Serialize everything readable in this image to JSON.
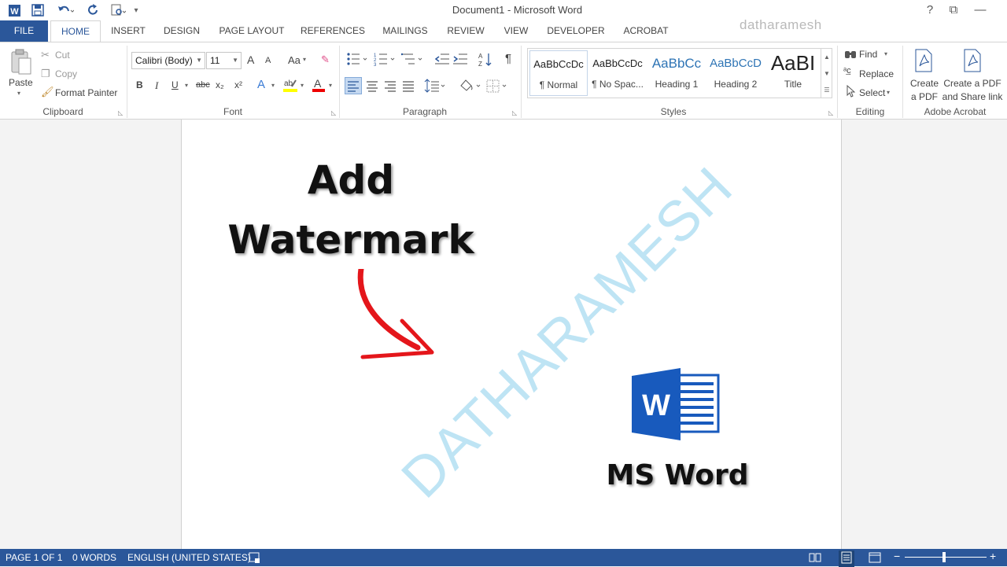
{
  "title_bar": {
    "app_icon": "word-icon",
    "save_icon": "save-icon",
    "undo_icon": "undo-icon",
    "redo_icon": "redo-icon",
    "print_preview_icon": "print-preview-icon",
    "customize_icon": "customize-qat-icon",
    "document_title": "Document1 - Microsoft Word",
    "account_name": "datharamesh",
    "help": "?",
    "ribbon_options": "⧉",
    "minimize": "—"
  },
  "tabs": [
    {
      "label": "FILE"
    },
    {
      "label": "HOME"
    },
    {
      "label": "INSERT"
    },
    {
      "label": "DESIGN"
    },
    {
      "label": "PAGE LAYOUT"
    },
    {
      "label": "REFERENCES"
    },
    {
      "label": "MAILINGS"
    },
    {
      "label": "REVIEW"
    },
    {
      "label": "VIEW"
    },
    {
      "label": "DEVELOPER"
    },
    {
      "label": "ACROBAT"
    }
  ],
  "clipboard": {
    "paste": "Paste",
    "cut": "Cut",
    "copy": "Copy",
    "format_painter": "Format Painter",
    "group_label": "Clipboard"
  },
  "font": {
    "font_name": "Calibri (Body)",
    "font_size": "11",
    "group_label": "Font",
    "bold": "B",
    "italic": "I",
    "underline": "U",
    "strikethrough": "abc",
    "subscript": "x₂",
    "superscript": "x²",
    "grow": "A",
    "shrink": "A",
    "change_case": "Aa"
  },
  "paragraph": {
    "group_label": "Paragraph",
    "sort": "A↓Z",
    "pilcrow": "¶"
  },
  "styles": {
    "group_label": "Styles",
    "items": [
      {
        "preview": "AaBbCcDc",
        "name": "¶ Normal"
      },
      {
        "preview": "AaBbCcDc",
        "name": "¶ No Spac..."
      },
      {
        "preview": "AaBbCc",
        "name": "Heading 1"
      },
      {
        "preview": "AaBbCcD",
        "name": "Heading 2"
      },
      {
        "preview": "AaBI",
        "name": "Title"
      }
    ]
  },
  "editing": {
    "group_label": "Editing",
    "find": "Find",
    "replace": "Replace",
    "select": "Select"
  },
  "acrobat": {
    "group_label": "Adobe Acrobat",
    "create_pdf_line1": "Create",
    "create_pdf_line2": "a PDF",
    "create_share_line1": "Create a PDF",
    "create_share_line2": "and Share link"
  },
  "document": {
    "heading_line1": "Add",
    "heading_line2": "Watermark",
    "watermark": "DATHARAMESH",
    "logo_letter": "W",
    "caption": "MS Word"
  },
  "status_bar": {
    "page": "PAGE 1 OF 1",
    "words": "0 WORDS",
    "language": "ENGLISH (UNITED STATES)"
  },
  "colors": {
    "accent": "#2b579a",
    "watermark": "#a9dcf1",
    "arrow": "#e4161b",
    "word_logo": "#185abd"
  }
}
